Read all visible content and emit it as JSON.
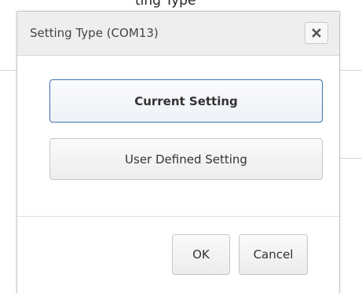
{
  "backdrop": {
    "title_fragment": "ting Type"
  },
  "dialog": {
    "title": "Setting Type (COM13)",
    "close_icon": "close-icon",
    "options": {
      "current_label": "Current Setting",
      "user_defined_label": "User Defined Setting"
    },
    "footer": {
      "ok_label": "OK",
      "cancel_label": "Cancel"
    }
  },
  "colors": {
    "header_bg": "#eeeeee",
    "focused_border": "#3c6eb4",
    "button_border": "#c6c6c6",
    "text": "#333333"
  }
}
